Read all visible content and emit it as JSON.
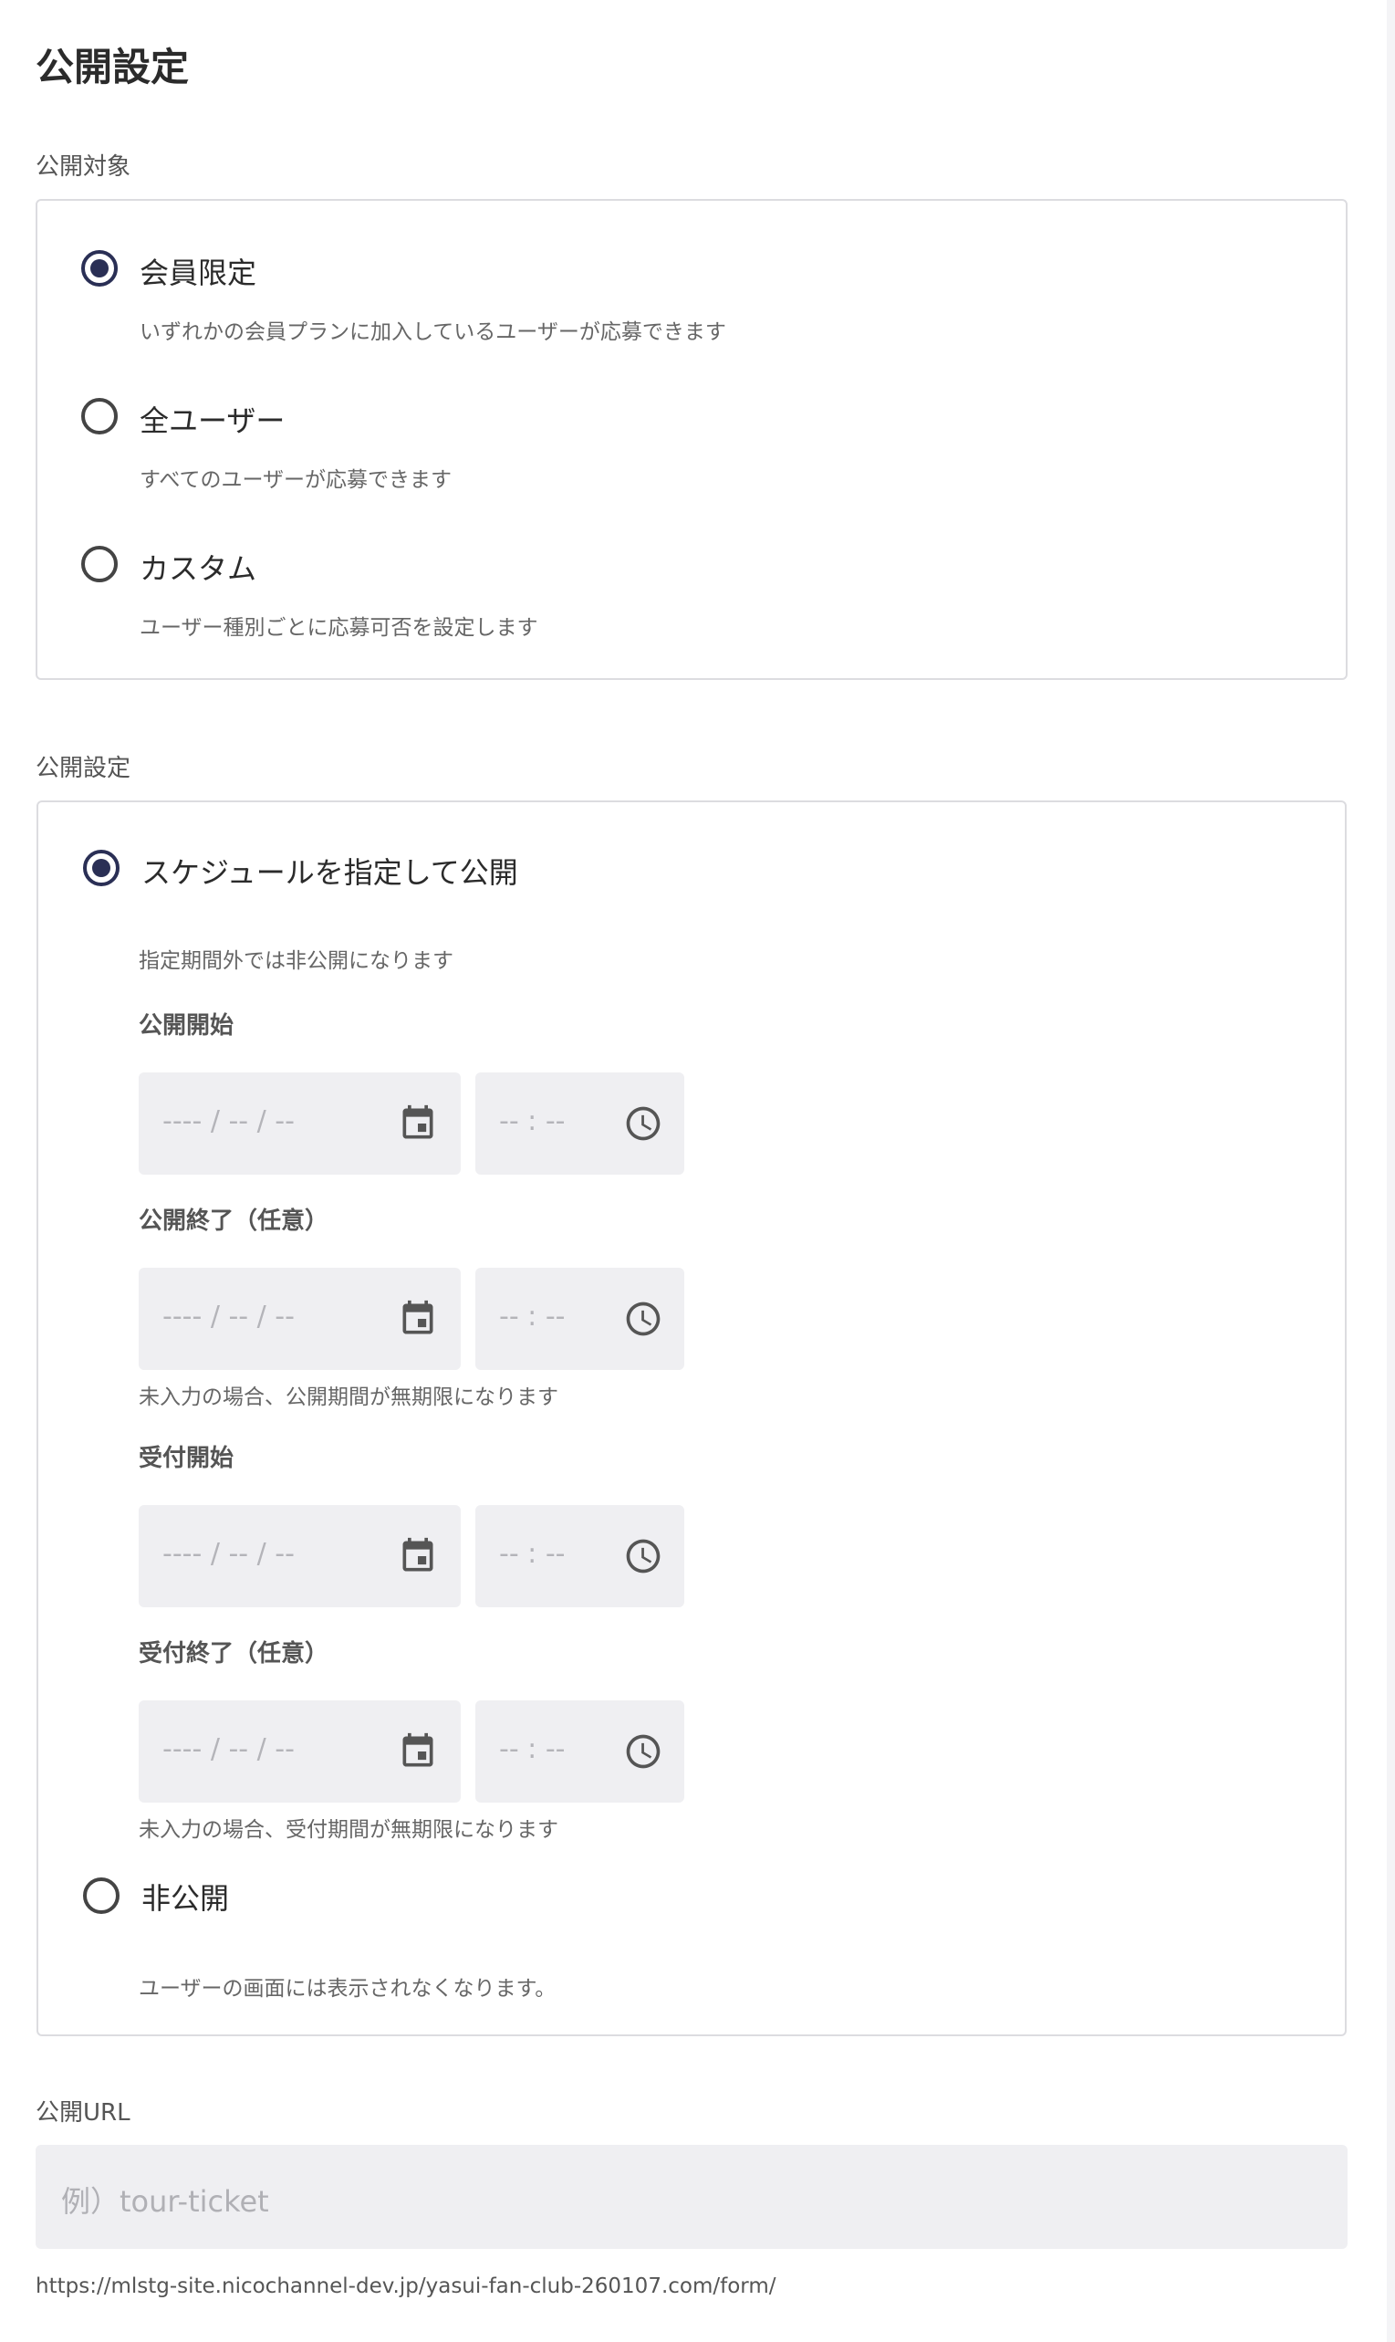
{
  "page_title": "公開設定",
  "audience": {
    "label": "公開対象",
    "options": [
      {
        "label": "会員限定",
        "description": "いずれかの会員プランに加入しているユーザーが応募できます",
        "checked": true
      },
      {
        "label": "全ユーザー",
        "description": "すべてのユーザーが応募できます",
        "checked": false
      },
      {
        "label": "カスタム",
        "description": "ユーザー種別ごとに応募可否を設定します",
        "checked": false
      }
    ]
  },
  "publish": {
    "label": "公開設定",
    "schedule": {
      "label": "スケジュールを指定して公開",
      "description": "指定期間外では非公開になります",
      "checked": true,
      "fields": [
        {
          "label": "公開開始",
          "date_placeholder": "---- / -- / --",
          "time_placeholder": "-- : --",
          "note": ""
        },
        {
          "label": "公開終了（任意）",
          "date_placeholder": "---- / -- / --",
          "time_placeholder": "-- : --",
          "note": "未入力の場合、公開期間が無期限になります"
        },
        {
          "label": "受付開始",
          "date_placeholder": "---- / -- / --",
          "time_placeholder": "-- : --",
          "note": ""
        },
        {
          "label": "受付終了（任意）",
          "date_placeholder": "---- / -- / --",
          "time_placeholder": "-- : --",
          "note": "未入力の場合、受付期間が無期限になります"
        }
      ]
    },
    "private": {
      "label": "非公開",
      "description": "ユーザーの画面には表示されなくなります。",
      "checked": false
    }
  },
  "url": {
    "label": "公開URL",
    "placeholder": "例）tour-ticket",
    "prefix": "https://mlstg-site.nicochannel-dev.jp/yasui-fan-club-260107.com/form/"
  },
  "icons": {
    "date": "calendar-icon",
    "time": "clock-icon"
  },
  "colors": {
    "accent": "#2a2f55",
    "input_bg": "#efeff2",
    "border": "#dcdce0"
  }
}
